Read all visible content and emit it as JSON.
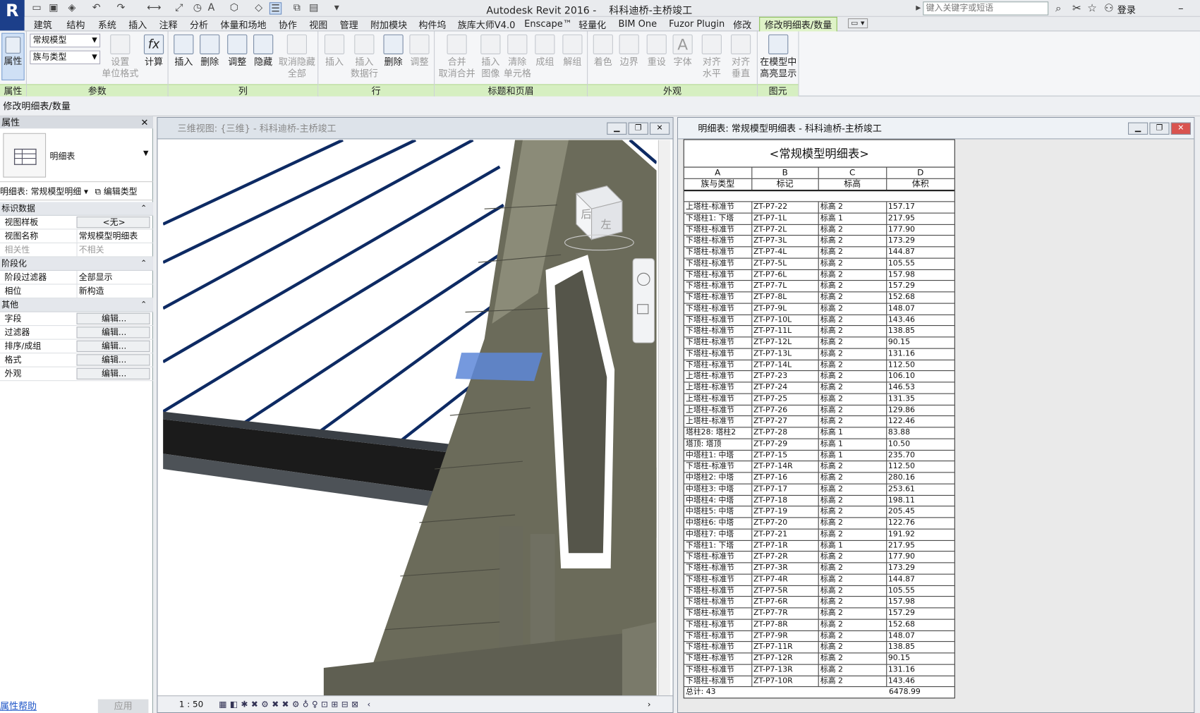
{
  "app": {
    "title": "Autodesk Revit 2016 -",
    "project": "科科迪桥-主桥竣工",
    "search_placeholder": "键入关键字或短语",
    "login": "登录",
    "logo": "R"
  },
  "ribbon_tabs": [
    "建筑",
    "结构",
    "系统",
    "插入",
    "注释",
    "分析",
    "体量和场地",
    "协作",
    "视图",
    "管理",
    "附加模块",
    "构件坞",
    "族库大师V4.0",
    "Enscape™",
    "轻量化",
    "BIM One",
    "Fuzor Plugin",
    "修改"
  ],
  "active_tab": "修改明细表/数量",
  "ribbon": {
    "groups": {
      "properties": "属性",
      "parameters": "参数",
      "columns": "列",
      "rows": "行",
      "titles": "标题和页眉",
      "appearance": "外观",
      "element": "图元"
    },
    "properties_btn": "属性",
    "combo1": "常规模型",
    "combo2": "族与类型",
    "param_btns": [
      "设置\n单位格式",
      "计算"
    ],
    "col_btns": [
      "插入",
      "删除",
      "调整",
      "隐藏",
      "取消隐藏\n全部"
    ],
    "row_btns": [
      "插入",
      "插入\n数据行",
      "删除",
      "调整"
    ],
    "title_btns": [
      "合并\n取消合并",
      "插入\n图像",
      "清除\n单元格",
      "成组",
      "解组"
    ],
    "appear_btns": [
      "着色",
      "边界",
      "重设",
      "字体",
      "对齐\n水平",
      "对齐\n垂直"
    ],
    "element_btn": "在模型中\n高亮显示"
  },
  "context_bar": "修改明细表/数量",
  "properties": {
    "header": "属性",
    "type_name": "明细表",
    "selector": "明细表: 常规模型明细",
    "edit_type": "编辑类型",
    "sections": {
      "identity": "标识数据",
      "phasing": "阶段化",
      "other": "其他"
    },
    "rows_identity": [
      {
        "label": "视图样板",
        "value": "<无>"
      },
      {
        "label": "视图名称",
        "value": "常规模型明细表"
      },
      {
        "label": "相关性",
        "value": "不相关"
      }
    ],
    "rows_phasing": [
      {
        "label": "阶段过滤器",
        "value": "全部显示"
      },
      {
        "label": "相位",
        "value": "新构造"
      }
    ],
    "rows_other": [
      {
        "label": "字段",
        "value": "编辑..."
      },
      {
        "label": "过滤器",
        "value": "编辑..."
      },
      {
        "label": "排序/成组",
        "value": "编辑..."
      },
      {
        "label": "格式",
        "value": "编辑..."
      },
      {
        "label": "外观",
        "value": "编辑..."
      }
    ],
    "help": "属性帮助",
    "apply": "应用"
  },
  "view3d": {
    "title": "三维视图: {三维} - 科科迪桥-主桥竣工",
    "scale": "1 : 50",
    "viewcube_top": "后",
    "viewcube_side": "左"
  },
  "schedule": {
    "window_title": "明细表: 常规模型明细表 - 科科迪桥-主桥竣工",
    "title": "<常规模型明细表>",
    "col_letters": [
      "A",
      "B",
      "C",
      "D"
    ],
    "col_headers": [
      "族与类型",
      "标记",
      "标高",
      "体积"
    ],
    "rows": [
      [
        "上塔柱-标准节",
        "ZT-P7-22",
        "标高 2",
        "157.17"
      ],
      [
        "下塔柱1: 下塔",
        "ZT-P7-1L",
        "标高 1",
        "217.95"
      ],
      [
        "下塔柱-标准节",
        "ZT-P7-2L",
        "标高 2",
        "177.90"
      ],
      [
        "下塔柱-标准节",
        "ZT-P7-3L",
        "标高 2",
        "173.29"
      ],
      [
        "下塔柱-标准节",
        "ZT-P7-4L",
        "标高 2",
        "144.87"
      ],
      [
        "下塔柱-标准节",
        "ZT-P7-5L",
        "标高 2",
        "105.55"
      ],
      [
        "下塔柱-标准节",
        "ZT-P7-6L",
        "标高 2",
        "157.98"
      ],
      [
        "下塔柱-标准节",
        "ZT-P7-7L",
        "标高 2",
        "157.29"
      ],
      [
        "下塔柱-标准节",
        "ZT-P7-8L",
        "标高 2",
        "152.68"
      ],
      [
        "下塔柱-标准节",
        "ZT-P7-9L",
        "标高 2",
        "148.07"
      ],
      [
        "下塔柱-标准节",
        "ZT-P7-10L",
        "标高 2",
        "143.46"
      ],
      [
        "下塔柱-标准节",
        "ZT-P7-11L",
        "标高 2",
        "138.85"
      ],
      [
        "下塔柱-标准节",
        "ZT-P7-12L",
        "标高 2",
        "90.15"
      ],
      [
        "下塔柱-标准节",
        "ZT-P7-13L",
        "标高 2",
        "131.16"
      ],
      [
        "下塔柱-标准节",
        "ZT-P7-14L",
        "标高 2",
        "112.50"
      ],
      [
        "上塔柱-标准节",
        "ZT-P7-23",
        "标高 2",
        "106.10"
      ],
      [
        "上塔柱-标准节",
        "ZT-P7-24",
        "标高 2",
        "146.53"
      ],
      [
        "上塔柱-标准节",
        "ZT-P7-25",
        "标高 2",
        "131.35"
      ],
      [
        "上塔柱-标准节",
        "ZT-P7-26",
        "标高 2",
        "129.86"
      ],
      [
        "上塔柱-标准节",
        "ZT-P7-27",
        "标高 2",
        "122.46"
      ],
      [
        "塔柱28: 塔柱2",
        "ZT-P7-28",
        "标高 1",
        "83.88"
      ],
      [
        "塔顶: 塔顶",
        "ZT-P7-29",
        "标高 1",
        "10.50"
      ],
      [
        "中塔柱1: 中塔",
        "ZT-P7-15",
        "标高 1",
        "235.70"
      ],
      [
        "下塔柱-标准节",
        "ZT-P7-14R",
        "标高 2",
        "112.50"
      ],
      [
        "中塔柱2: 中塔",
        "ZT-P7-16",
        "标高 2",
        "280.16"
      ],
      [
        "中塔柱3: 中塔",
        "ZT-P7-17",
        "标高 2",
        "253.61"
      ],
      [
        "中塔柱4: 中塔",
        "ZT-P7-18",
        "标高 2",
        "198.11"
      ],
      [
        "中塔柱5: 中塔",
        "ZT-P7-19",
        "标高 2",
        "205.45"
      ],
      [
        "中塔柱6: 中塔",
        "ZT-P7-20",
        "标高 2",
        "122.76"
      ],
      [
        "中塔柱7: 中塔",
        "ZT-P7-21",
        "标高 2",
        "191.92"
      ],
      [
        "下塔柱1: 下塔",
        "ZT-P7-1R",
        "标高 1",
        "217.95"
      ],
      [
        "下塔柱-标准节",
        "ZT-P7-2R",
        "标高 2",
        "177.90"
      ],
      [
        "下塔柱-标准节",
        "ZT-P7-3R",
        "标高 2",
        "173.29"
      ],
      [
        "下塔柱-标准节",
        "ZT-P7-4R",
        "标高 2",
        "144.87"
      ],
      [
        "下塔柱-标准节",
        "ZT-P7-5R",
        "标高 2",
        "105.55"
      ],
      [
        "下塔柱-标准节",
        "ZT-P7-6R",
        "标高 2",
        "157.98"
      ],
      [
        "下塔柱-标准节",
        "ZT-P7-7R",
        "标高 2",
        "157.29"
      ],
      [
        "下塔柱-标准节",
        "ZT-P7-8R",
        "标高 2",
        "152.68"
      ],
      [
        "下塔柱-标准节",
        "ZT-P7-9R",
        "标高 2",
        "148.07"
      ],
      [
        "下塔柱-标准节",
        "ZT-P7-11R",
        "标高 2",
        "138.85"
      ],
      [
        "下塔柱-标准节",
        "ZT-P7-12R",
        "标高 2",
        "90.15"
      ],
      [
        "下塔柱-标准节",
        "ZT-P7-13R",
        "标高 2",
        "131.16"
      ],
      [
        "下塔柱-标准节",
        "ZT-P7-10R",
        "标高 2",
        "143.46"
      ]
    ],
    "total_label": "总计: 43",
    "total_volume": "6478.99"
  }
}
